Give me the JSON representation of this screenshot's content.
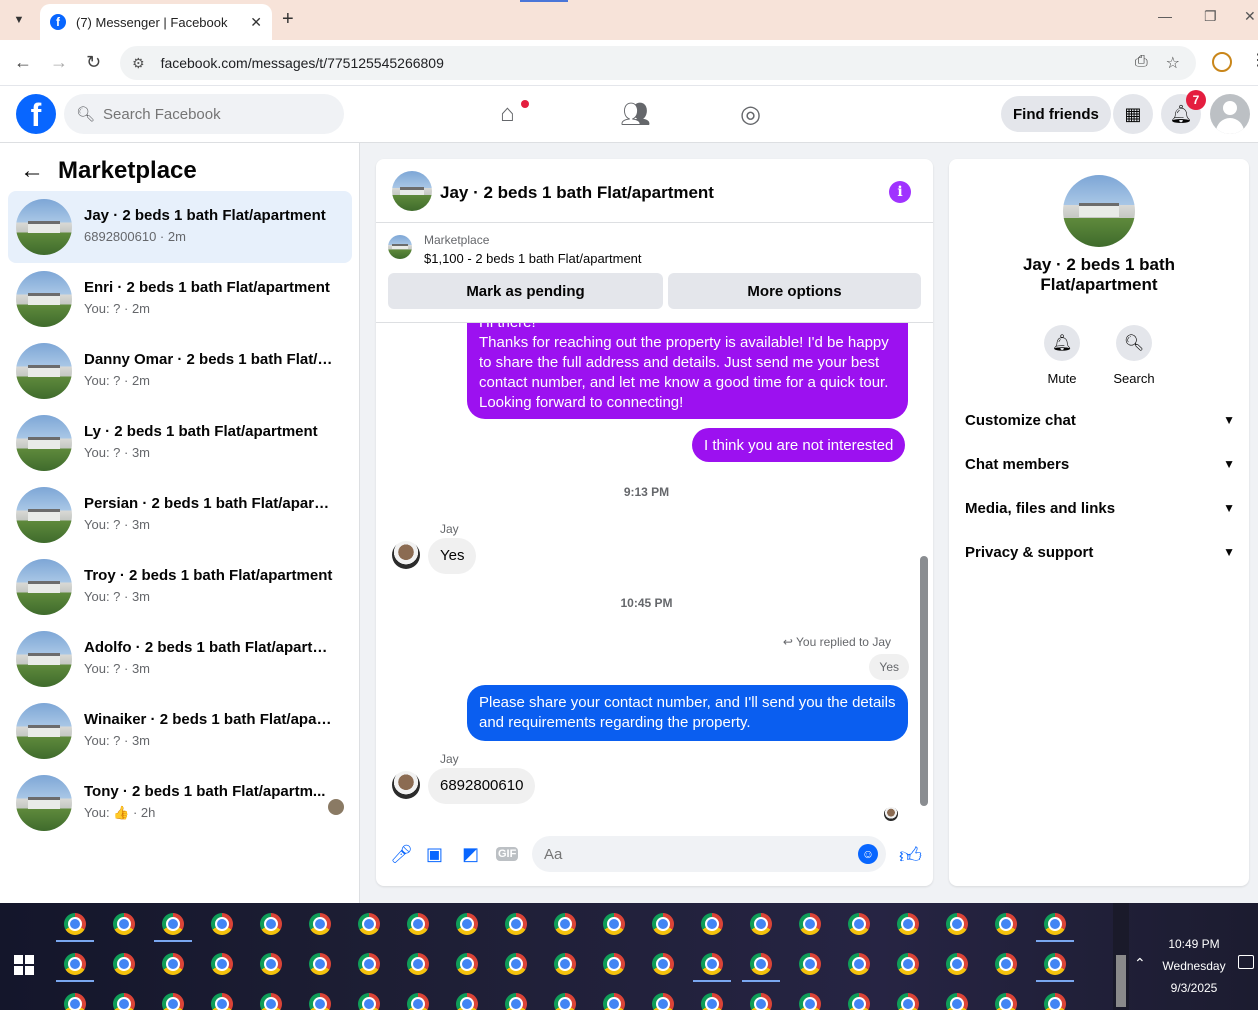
{
  "browser": {
    "tab_title": "(7) Messenger | Facebook",
    "url": "facebook.com/messages/t/775125545266809"
  },
  "header": {
    "search_placeholder": "Search Facebook",
    "find_friends": "Find friends",
    "notification_count": "7"
  },
  "sidebar": {
    "title": "Marketplace",
    "conversations": [
      {
        "name": "Jay · 2 beds 1 bath Flat/apartment",
        "sub": "6892800610 · 2m",
        "active": true
      },
      {
        "name": "Enri · 2 beds 1 bath Flat/apartment",
        "sub": "You: ? · 2m"
      },
      {
        "name": "Danny Omar · 2 beds 1 bath Flat/a...",
        "sub": "You: ? · 2m"
      },
      {
        "name": "Ly · 2 beds 1 bath Flat/apartment",
        "sub": "You: ? · 3m"
      },
      {
        "name": "Persian · 2 beds 1 bath Flat/apartm...",
        "sub": "You: ? · 3m"
      },
      {
        "name": "Troy · 2 beds 1 bath Flat/apartment",
        "sub": "You: ? · 3m"
      },
      {
        "name": "Adolfo · 2 beds 1 bath Flat/apartm...",
        "sub": "You: ? · 3m"
      },
      {
        "name": "Winaiker · 2 beds 1 bath Flat/apart...",
        "sub": "You: ? · 3m"
      },
      {
        "name": "Tony · 2 beds 1 bath Flat/apartm...",
        "sub": "You: 👍 · 2h"
      }
    ]
  },
  "chat": {
    "title": "Jay · 2 beds 1 bath Flat/apartment",
    "marketplace_label": "Marketplace",
    "listing": "$1,100 - 2 beds 1 bath Flat/apartment",
    "mark_pending": "Mark as pending",
    "more_options": "More options",
    "msg_long": "Hi there!\nThanks for reaching out the property is available! I'd be happy to share the full address and details. Just send me your best contact number, and let me know a good time for a quick tour. Looking forward to connecting!",
    "msg_not_interested": "I think you are not interested",
    "ts_1": "9:13 PM",
    "sender_1": "Jay",
    "msg_yes": "Yes",
    "ts_2": "10:45 PM",
    "replied_to": "You replied to Jay",
    "quoted": "Yes",
    "msg_please_share": "Please share your contact number, and I'll send you the details and requirements regarding the property.",
    "sender_2": "Jay",
    "msg_phone": "6892800610",
    "composer_placeholder": "Aa"
  },
  "info_panel": {
    "name": "Jay · 2 beds 1 bath Flat/apartment",
    "mute": "Mute",
    "search": "Search",
    "sections": [
      "Customize chat",
      "Chat members",
      "Media, files and links",
      "Privacy & support"
    ]
  },
  "taskbar": {
    "time": "10:49 PM",
    "day": "Wednesday",
    "date": "9/3/2025"
  },
  "colors": {
    "purple_bubble": "#9c11f0",
    "blue_bubble": "#0a5ef0",
    "fb_blue": "#0866ff"
  }
}
